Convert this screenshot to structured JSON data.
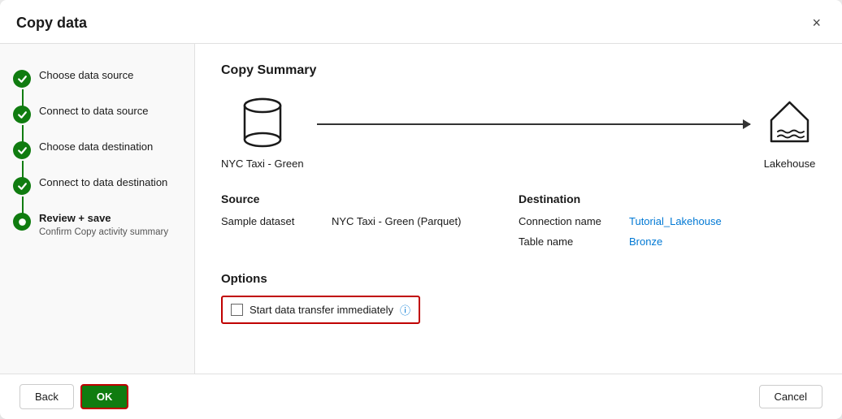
{
  "dialog": {
    "title": "Copy data",
    "close_label": "×"
  },
  "sidebar": {
    "steps": [
      {
        "id": "choose-source",
        "label": "Choose data source",
        "sublabel": "",
        "state": "completed",
        "has_connector": true
      },
      {
        "id": "connect-source",
        "label": "Connect to data source",
        "sublabel": "",
        "state": "completed",
        "has_connector": true
      },
      {
        "id": "choose-destination",
        "label": "Choose data destination",
        "sublabel": "",
        "state": "completed",
        "has_connector": true
      },
      {
        "id": "connect-destination",
        "label": "Connect to data destination",
        "sublabel": "",
        "state": "completed",
        "has_connector": true
      },
      {
        "id": "review-save",
        "label": "Review + save",
        "sublabel": "Confirm Copy activity summary",
        "state": "current",
        "has_connector": false
      }
    ]
  },
  "main": {
    "section_title": "Copy Summary",
    "flow": {
      "source_label": "NYC Taxi - Green",
      "dest_label": "Lakehouse"
    },
    "source": {
      "title": "Source",
      "fields": [
        {
          "key": "Sample dataset",
          "value": "NYC Taxi - Green (Parquet)"
        }
      ]
    },
    "destination": {
      "title": "Destination",
      "fields": [
        {
          "key": "Connection name",
          "value": "Tutorial_Lakehouse"
        },
        {
          "key": "Table name",
          "value": "Bronze"
        }
      ]
    },
    "options": {
      "title": "Options",
      "checkbox_label": "Start data transfer immediately",
      "checkbox_checked": false
    }
  },
  "footer": {
    "back_label": "Back",
    "ok_label": "OK",
    "cancel_label": "Cancel"
  }
}
